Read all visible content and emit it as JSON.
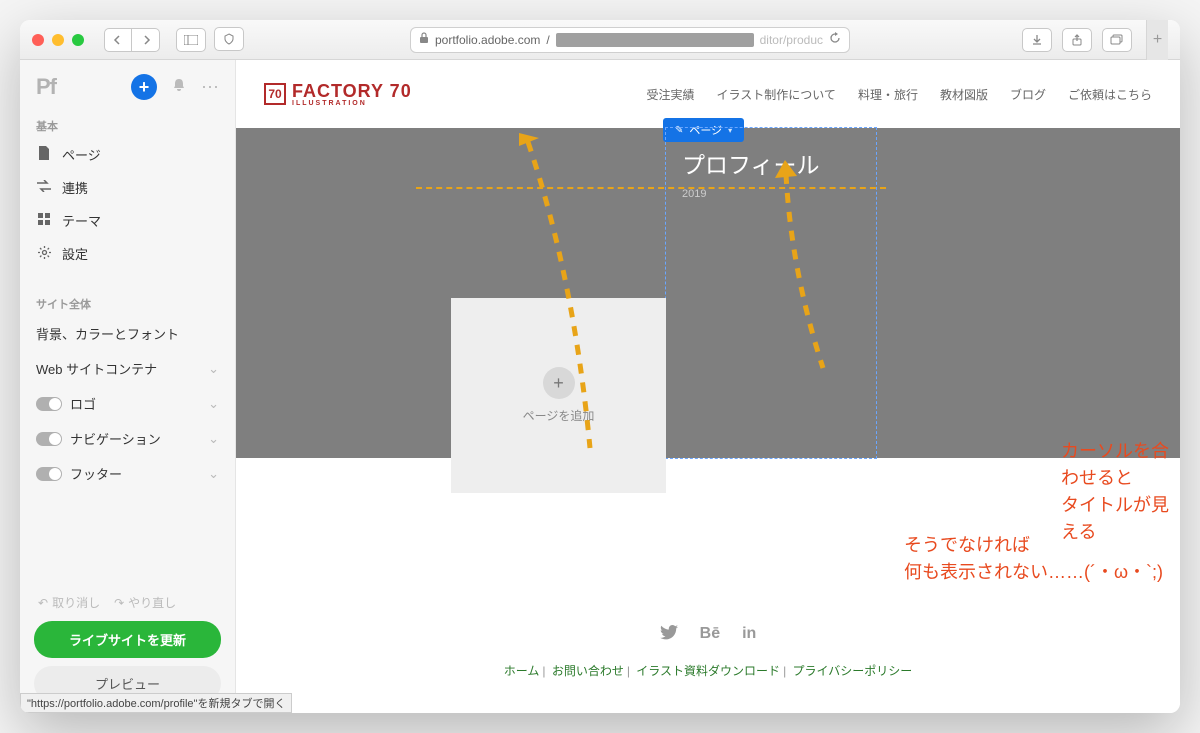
{
  "browser": {
    "url_host": "portfolio.adobe.com",
    "url_path_suffix": "ditor/produc"
  },
  "sidebar": {
    "logo": "Pf",
    "sections": {
      "basic_label": "基本",
      "sitewide_label": "サイト全体"
    },
    "items": {
      "pages": "ページ",
      "integrations": "連携",
      "themes": "テーマ",
      "settings": "設定",
      "bg_colors": "背景、カラーとフォント",
      "container": "Web サイトコンテナ",
      "logo_toggle": "ロゴ",
      "nav_toggle": "ナビゲーション",
      "footer_toggle": "フッター"
    },
    "undo": "取り消し",
    "redo": "やり直し",
    "update_btn": "ライブサイトを更新",
    "preview_btn": "プレビュー"
  },
  "site": {
    "logo_main": "FACTORY 70",
    "logo_sub": "ILLUSTRATION",
    "nav": [
      "受注実績",
      "イラスト制作について",
      "料理・旅行",
      "教材図版",
      "ブログ",
      "ご依頼はこちら"
    ],
    "page_label": "ページ",
    "hover_title": "プロフィール",
    "hover_year": "2019",
    "add_page": "ページを追加",
    "footer_links": [
      "ホーム",
      "お問い合わせ",
      "イラスト資料ダウンロード",
      "プライバシーポリシー"
    ]
  },
  "annotations": {
    "a1_line1": "カーソルを合わせると",
    "a1_line2": "タイトルが見える",
    "a2_line1": "そうでなければ",
    "a2_line2": "何も表示されない……(´・ω・`;)"
  },
  "status_tooltip": "\"https://portfolio.adobe.com/profile\"を新規タブで開く",
  "colors": {
    "accent_blue": "#1473e6",
    "accent_green": "#2ab63a",
    "annot_orange": "#e8a418",
    "annot_red": "#e84a1f",
    "logo_red": "#b22a2a"
  }
}
